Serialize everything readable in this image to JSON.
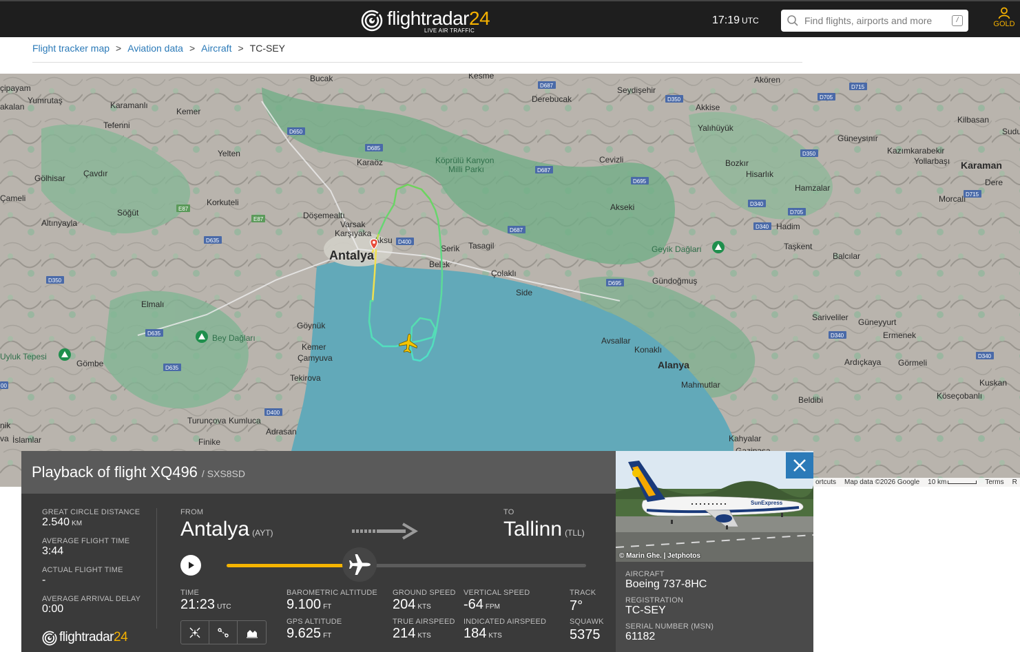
{
  "header": {
    "logo_word": "flightradar",
    "logo_num": "24",
    "logo_sub": "LIVE AIR TRAFFIC",
    "clock": "17:19",
    "clock_tz": "UTC",
    "search_placeholder": "Find flights, airports and more",
    "search_shortcut": "/",
    "account_label": "GOLD"
  },
  "breadcrumb": {
    "items": [
      "Flight tracker map",
      "Aviation data",
      "Aircraft"
    ],
    "current": "TC-SEY",
    "separator": ">"
  },
  "map": {
    "places": [
      "Bucak",
      "Kesme",
      "Akören",
      "Seydişehir",
      "Derebucak",
      "Akkise",
      "Yalıhüyük",
      "Kilbasan",
      "Sudu",
      "çipayam",
      "Yumrutaş",
      "Karamanlı",
      "Kemer",
      "akalan",
      "Tefenni",
      "Yelten",
      "Çavdır",
      "Gölhisar",
      "Çameli",
      "Korkuteli",
      "Söğüt",
      "Altınyayla",
      "Döşemealtı",
      "Varsak",
      "Karşıyaka",
      "Aksu",
      "Antalya",
      "Serik",
      "Tasagil",
      "Belek",
      "Çolaklı",
      "Side",
      "Karaöz",
      "Köprülü Kanyon Milli Parkı",
      "Cevizli",
      "Akseki",
      "Bozkır",
      "Hisarlık",
      "Hamzalar",
      "Kazımkarabekir",
      "Yollarbaşı",
      "Karaman",
      "Dere",
      "Morcalı",
      "Güneysınır",
      "Hadim",
      "Taşkent",
      "Geyik Dağları",
      "Balcılar",
      "Gündoğmuş",
      "Elmalı",
      "Göynük",
      "Kemer",
      "Çamyuva",
      "Tekirova",
      "Bey Dağları",
      "Uyluk Tepesi",
      "Gömbe",
      "Avsallar",
      "Konaklı",
      "Alanya",
      "Mahmutlar",
      "Sariveliler",
      "Güneyyurt",
      "Ermenek",
      "Ardıçkaya",
      "Görmeli",
      "Kuskan",
      "Köseçobanlı",
      "Beldibi",
      "Kahyalar",
      "Turunçova",
      "Kumluca",
      "Adrasan",
      "Finike",
      "İslamlar",
      "Gazipaşa",
      "nik",
      "va"
    ],
    "roads": [
      "D687",
      "D350",
      "D705",
      "D715",
      "D650",
      "D685",
      "D687",
      "D695",
      "D350",
      "E87",
      "E87",
      "D635",
      "D400",
      "D687",
      "D340",
      "D705",
      "D340",
      "D715",
      "D350",
      "D695",
      "D635",
      "D635",
      "D340",
      "D340",
      "D400",
      "00"
    ],
    "attribution": [
      "ortcuts",
      "Map data ©2026 Google",
      "10 km",
      "Terms",
      "R"
    ]
  },
  "playback": {
    "title": "Playback of flight XQ496",
    "callsign": "/ SXS8SD",
    "great_circle_label": "GREAT CIRCLE DISTANCE",
    "great_circle_value": "2.540",
    "great_circle_unit": "KM",
    "avg_time_label": "AVERAGE FLIGHT TIME",
    "avg_time_value": "3:44",
    "actual_time_label": "ACTUAL FLIGHT TIME",
    "actual_time_value": "-",
    "avg_delay_label": "AVERAGE ARRIVAL DELAY",
    "avg_delay_value": "0:00",
    "from_label": "FROM",
    "from_city": "Antalya",
    "from_code": "(AYT)",
    "to_label": "TO",
    "to_city": "Tallinn",
    "to_code": "(TLL)",
    "progress": 0.37,
    "time_label": "TIME",
    "time_value": "21:23",
    "time_unit": "UTC",
    "baro_label": "BAROMETRIC ALTITUDE",
    "baro_value": "9.100",
    "baro_unit": "FT",
    "gps_label": "GPS ALTITUDE",
    "gps_value": "9.625",
    "gps_unit": "FT",
    "gs_label": "GROUND SPEED",
    "gs_value": "204",
    "gs_unit": "KTS",
    "tas_label": "TRUE AIRSPEED",
    "tas_value": "214",
    "tas_unit": "KTS",
    "vs_label": "VERTICAL SPEED",
    "vs_value": "-64",
    "vs_unit": "FPM",
    "ias_label": "INDICATED AIRSPEED",
    "ias_value": "184",
    "ias_unit": "KTS",
    "track_label": "TRACK",
    "track_value": "7°",
    "squawk_label": "SQUAWK",
    "squawk_value": "5375"
  },
  "aircraft": {
    "photo_credit": "© Marin Ghe. | Jetphotos",
    "aircraft_label": "AIRCRAFT",
    "aircraft_value": "Boeing 737-8HC",
    "reg_label": "REGISTRATION",
    "reg_value": "TC-SEY",
    "msn_label": "SERIAL NUMBER (MSN)",
    "msn_value": "61182",
    "livery_text": "SunExpress"
  },
  "colors": {
    "accent_yellow": "#f5b400",
    "brand_blue": "#2b7ab8",
    "sea": "#62a9b9",
    "track_start": "#f4e04d",
    "track_mid": "#6ed35a",
    "track_end": "#4fe0c8"
  }
}
